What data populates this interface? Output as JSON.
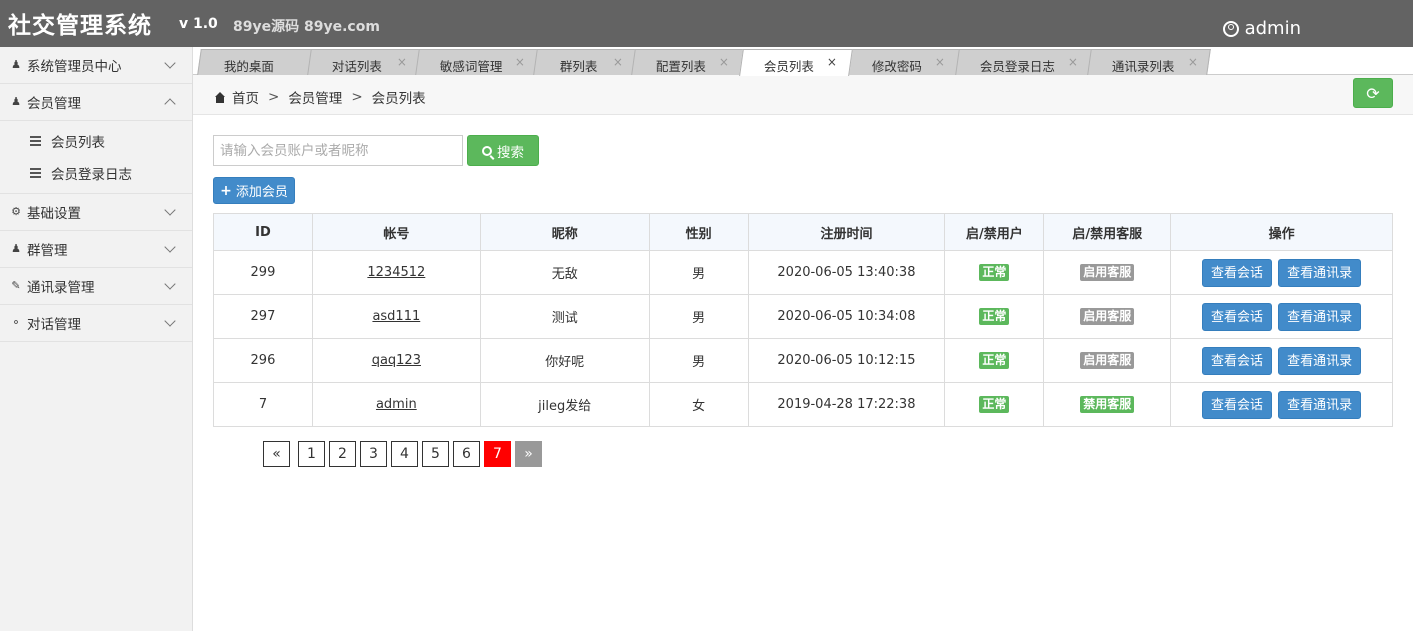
{
  "header": {
    "title": "社交管理系统",
    "version": "v 1.0",
    "site": "89ye源码 89ye.com",
    "user": "admin"
  },
  "sidebar": {
    "items": [
      {
        "label": "系统管理员中心",
        "icon": "user-icon"
      },
      {
        "label": "会员管理",
        "icon": "user-icon"
      },
      {
        "label": "基础设置",
        "icon": "gear-icon"
      },
      {
        "label": "群管理",
        "icon": "group-icon"
      },
      {
        "label": "通讯录管理",
        "icon": "edit-icon"
      },
      {
        "label": "对话管理",
        "icon": "chat-icon"
      }
    ],
    "sub_items": [
      "会员列表",
      "会员登录日志"
    ]
  },
  "tabs": [
    {
      "label": "我的桌面"
    },
    {
      "label": "对话列表"
    },
    {
      "label": "敏感词管理"
    },
    {
      "label": "群列表"
    },
    {
      "label": "配置列表"
    },
    {
      "label": "会员列表"
    },
    {
      "label": "修改密码"
    },
    {
      "label": "会员登录日志"
    },
    {
      "label": "通讯录列表"
    }
  ],
  "close_glyph": "×",
  "breadcrumb": {
    "home": "首页",
    "sep": ">",
    "level1": "会员管理",
    "level2": "会员列表"
  },
  "search": {
    "placeholder": "请输入会员账户或者昵称",
    "button": "搜索",
    "add_button": "添加会员"
  },
  "table": {
    "headers": [
      "ID",
      "帐号",
      "昵称",
      "性别",
      "注册时间",
      "启/禁用户",
      "启/禁用客服",
      "操作"
    ],
    "rows": [
      {
        "id": "299",
        "account": "1234512",
        "nickname": "无敌",
        "gender": "男",
        "time": "2020-06-05 13:40:38",
        "status": "正常",
        "service": "启用客服",
        "service_color": "gray",
        "btn1": "查看会话",
        "btn2": "查看通讯录"
      },
      {
        "id": "297",
        "account": "asd111",
        "nickname": "测试",
        "gender": "男",
        "time": "2020-06-05 10:34:08",
        "status": "正常",
        "service": "启用客服",
        "service_color": "gray",
        "btn1": "查看会话",
        "btn2": "查看通讯录"
      },
      {
        "id": "296",
        "account": "qaq123",
        "nickname": "你好呢",
        "gender": "男",
        "time": "2020-06-05 10:12:15",
        "status": "正常",
        "service": "启用客服",
        "service_color": "gray",
        "btn1": "查看会话",
        "btn2": "查看通讯录"
      },
      {
        "id": "7",
        "account": "admin",
        "nickname": "jileg发给",
        "gender": "女",
        "time": "2019-04-28 17:22:38",
        "status": "正常",
        "service": "禁用客服",
        "service_color": "green",
        "btn1": "查看会话",
        "btn2": "查看通讯录"
      }
    ]
  },
  "pagination": {
    "prev": "«",
    "pages": [
      "1",
      "2",
      "3",
      "4",
      "5",
      "6",
      "7"
    ],
    "current": "7",
    "next": "»"
  },
  "colors": {
    "header_bg": "#636363",
    "green": "#5cb85c",
    "blue": "#428bca",
    "current_page": "#ff0000"
  }
}
